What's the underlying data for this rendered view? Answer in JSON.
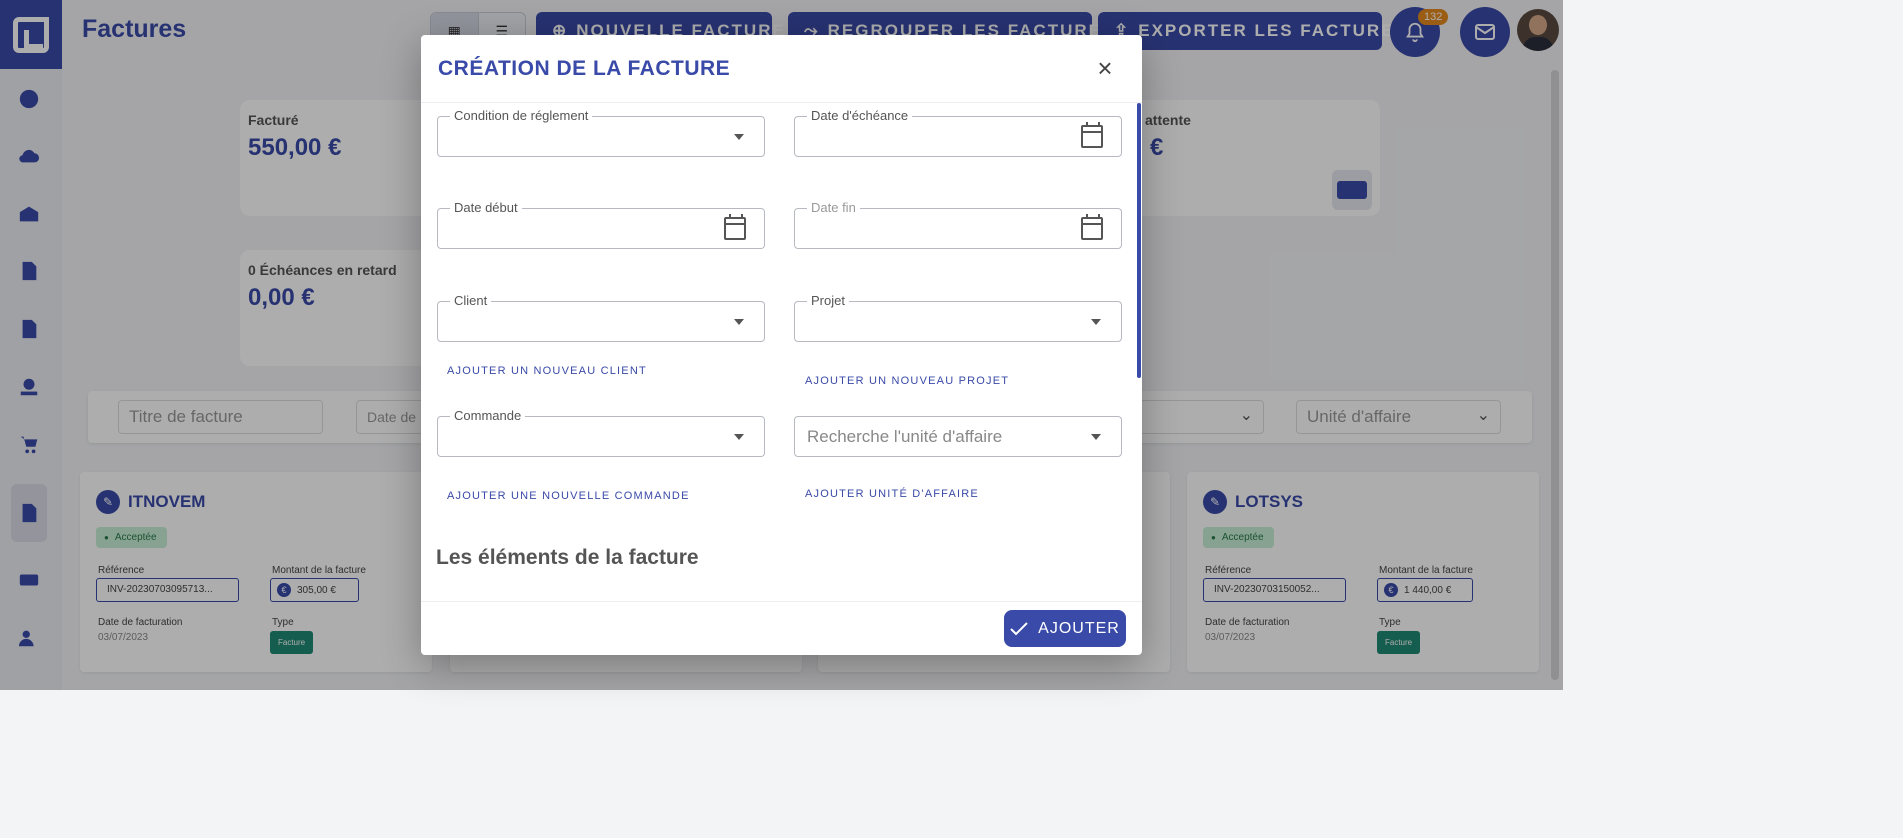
{
  "app": {
    "page_title": "Factures",
    "notification_count": "132"
  },
  "toolbar": {
    "new_invoice": "NOUVELLE FACTURE",
    "group_invoices": "REGROUPER LES FACTURES",
    "export_invoices": "EXPORTER LES FACTURES"
  },
  "stats": [
    {
      "label": "Facturé",
      "value": "550,00 €"
    },
    {
      "label": "attente",
      "value": "€"
    },
    {
      "label": "0 Échéances en retard",
      "value": "0,00 €"
    }
  ],
  "filters": {
    "title_placeholder": "Titre de facture",
    "date_placeholder": "Date de",
    "business_unit_placeholder": "Unité d'affaire"
  },
  "invoices": [
    {
      "client": "ITNOVEM",
      "status": "Acceptée",
      "reference_label": "Référence",
      "reference": "INV-20230703095713...",
      "amount_label": "Montant de la facture",
      "amount": "305,00 €",
      "date_label": "Date de facturation",
      "date": "03/07/2023",
      "type_label": "Type",
      "type": "Facture"
    },
    {
      "client": "LOTSYS",
      "status": "Acceptée",
      "reference_label": "Référence",
      "reference": "INV-20230703150052...",
      "amount_label": "Montant de la facture",
      "amount": "1 440,00 €",
      "date_label": "Date de facturation",
      "date": "03/07/2023",
      "type_label": "Type",
      "type": "Facture"
    }
  ],
  "modal": {
    "title": "CRÉATION DE LA FACTURE",
    "close": "×",
    "fields": {
      "payment_condition": "Condition de réglement",
      "due_date": "Date d'échéance",
      "start_date": "Date début",
      "end_date": "Date fin",
      "client": "Client",
      "project": "Projet",
      "order": "Commande",
      "business_unit_placeholder": "Recherche l'unité d'affaire"
    },
    "links": {
      "add_client": "AJOUTER UN NOUVEAU CLIENT",
      "add_project": "AJOUTER UN NOUVEAU PROJET",
      "add_order": "AJOUTER UNE NOUVELLE COMMANDE",
      "add_business_unit": "AJOUTER UNITÉ D'AFFAIRE"
    },
    "section_title": "Les éléments de la facture",
    "submit": "AJOUTER"
  },
  "colors": {
    "primary": "#3a4aa8",
    "badge": "#e58a1e",
    "status_accepted": "#c8efd6",
    "type_tag": "#1f8a74"
  }
}
